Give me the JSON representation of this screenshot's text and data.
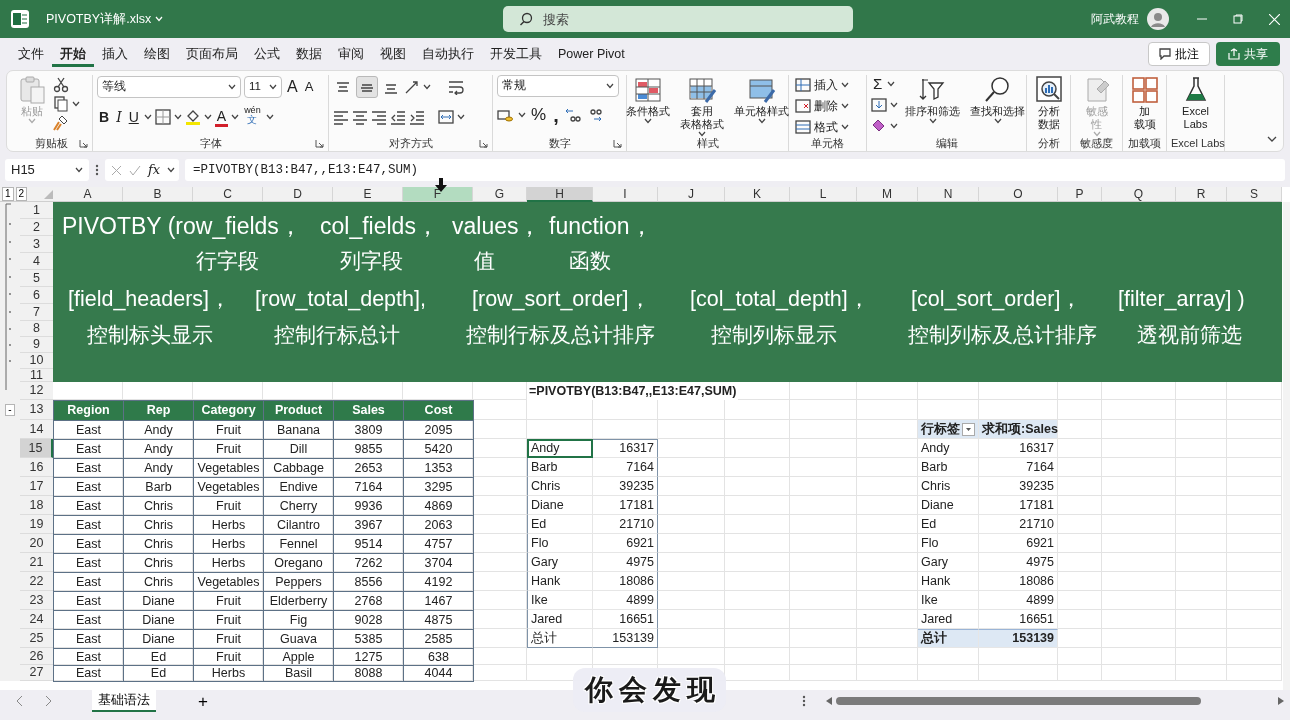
{
  "title_bar": {
    "file_name": "PIVOTBY详解.xlsx",
    "search_placeholder": "搜索",
    "user": "阿武教程"
  },
  "menu_tabs": [
    {
      "label": "文件",
      "selected": false
    },
    {
      "label": "开始",
      "selected": true
    },
    {
      "label": "插入",
      "selected": false
    },
    {
      "label": "绘图",
      "selected": false
    },
    {
      "label": "页面布局",
      "selected": false
    },
    {
      "label": "公式",
      "selected": false
    },
    {
      "label": "数据",
      "selected": false
    },
    {
      "label": "审阅",
      "selected": false
    },
    {
      "label": "视图",
      "selected": false
    },
    {
      "label": "自动执行",
      "selected": false
    },
    {
      "label": "开发工具",
      "selected": false
    },
    {
      "label": "Power Pivot",
      "selected": false
    }
  ],
  "menu_actions": [
    {
      "label": "批注",
      "kind": "comment"
    },
    {
      "label": "共享",
      "kind": "share"
    }
  ],
  "ribbon": [
    {
      "kind": "clipboard",
      "label": "剪贴板",
      "launcher": true,
      "paste": {
        "label": "粘贴",
        "disabled": true
      }
    },
    {
      "kind": "font",
      "label": "字体",
      "launcher": true,
      "font_name": "等线",
      "font_size": "11",
      "size_buttons": [
        "A",
        "A"
      ],
      "style_buttons": [
        "B",
        "I",
        "U"
      ],
      "font_color": "A",
      "phonetic": [
        "wén",
        "文"
      ]
    },
    {
      "kind": "alignment",
      "label": "对齐方式",
      "launcher": true,
      "vertical_align": [
        {
          "selected": false
        },
        {
          "selected": true
        },
        {
          "selected": false
        }
      ]
    },
    {
      "kind": "number",
      "label": "数字",
      "launcher": true,
      "number_format": "常规",
      "style_buttons": [
        "%",
        ","
      ]
    },
    {
      "kind": "large",
      "label": "样式",
      "launcher": false,
      "buttons": [
        {
          "lines": [
            "条件格式"
          ],
          "dropdown": true,
          "disabled": false
        },
        {
          "lines": [
            "套用",
            "表格格式"
          ],
          "dropdown": true,
          "disabled": false
        },
        {
          "lines": [
            "单元格样式"
          ],
          "dropdown": true,
          "disabled": false
        }
      ]
    },
    {
      "kind": "cells",
      "label": "单元格",
      "launcher": false,
      "buttons": [
        "插入",
        "删除",
        "格式"
      ]
    },
    {
      "kind": "editing",
      "label": "编辑",
      "launcher": false,
      "autosum": "Σ",
      "buttons": [
        {
          "lines": [
            "排序和筛选"
          ],
          "dropdown": true,
          "disabled": false
        },
        {
          "lines": [
            "查找和选择"
          ],
          "dropdown": true,
          "disabled": false
        }
      ]
    },
    {
      "kind": "large",
      "label": "分析",
      "launcher": false,
      "buttons": [
        {
          "lines": [
            "分析",
            "数据"
          ],
          "dropdown": false,
          "disabled": false
        }
      ]
    },
    {
      "kind": "large",
      "label": "敏感度",
      "launcher": false,
      "buttons": [
        {
          "lines": [
            "敏感",
            "性"
          ],
          "dropdown": true,
          "disabled": true
        }
      ]
    },
    {
      "kind": "large",
      "label": "加载项",
      "launcher": false,
      "buttons": [
        {
          "lines": [
            "加",
            "载项"
          ],
          "dropdown": false,
          "disabled": false
        }
      ]
    },
    {
      "kind": "large",
      "label": "Excel Labs",
      "launcher": false,
      "buttons": [
        {
          "lines": [
            "Excel",
            "Labs"
          ],
          "dropdown": false,
          "disabled": false
        }
      ]
    }
  ],
  "formula_bar": {
    "name_box": "H15",
    "fx": "fx",
    "formula": "=PIVOTBY(B13:B47,,E13:E47,SUM)"
  },
  "outline_levels": [
    "1",
    "2"
  ],
  "outline_collapse": "-",
  "columns": [
    {
      "label": "A",
      "selected": false,
      "drop_target": false
    },
    {
      "label": "B",
      "selected": false,
      "drop_target": false
    },
    {
      "label": "C",
      "selected": false,
      "drop_target": false
    },
    {
      "label": "D",
      "selected": false,
      "drop_target": false
    },
    {
      "label": "E",
      "selected": false,
      "drop_target": false
    },
    {
      "label": "F",
      "selected": false,
      "drop_target": true
    },
    {
      "label": "G",
      "selected": false,
      "drop_target": false
    },
    {
      "label": "H",
      "selected": true,
      "drop_target": false
    },
    {
      "label": "I",
      "selected": false,
      "drop_target": false
    },
    {
      "label": "J",
      "selected": false,
      "drop_target": false
    },
    {
      "label": "K",
      "selected": false,
      "drop_target": false
    },
    {
      "label": "L",
      "selected": false,
      "drop_target": false
    },
    {
      "label": "M",
      "selected": false,
      "drop_target": false
    },
    {
      "label": "N",
      "selected": false,
      "drop_target": false
    },
    {
      "label": "O",
      "selected": false,
      "drop_target": false
    },
    {
      "label": "P",
      "selected": false,
      "drop_target": false
    },
    {
      "label": "Q",
      "selected": false,
      "drop_target": false
    },
    {
      "label": "R",
      "selected": false,
      "drop_target": false
    },
    {
      "label": "S",
      "selected": false,
      "drop_target": false
    }
  ],
  "rows": [
    {
      "label": "1",
      "selected": false
    },
    {
      "label": "2",
      "selected": false
    },
    {
      "label": "3",
      "selected": false
    },
    {
      "label": "4",
      "selected": false
    },
    {
      "label": "5",
      "selected": false
    },
    {
      "label": "6",
      "selected": false
    },
    {
      "label": "7",
      "selected": false
    },
    {
      "label": "8",
      "selected": false
    },
    {
      "label": "9",
      "selected": false
    },
    {
      "label": "10",
      "selected": false
    },
    {
      "label": "11",
      "selected": false
    },
    {
      "label": "12",
      "selected": false
    },
    {
      "label": "13",
      "selected": false
    },
    {
      "label": "14",
      "selected": false
    },
    {
      "label": "15",
      "selected": true
    },
    {
      "label": "16",
      "selected": false
    },
    {
      "label": "17",
      "selected": false
    },
    {
      "label": "18",
      "selected": false
    },
    {
      "label": "19",
      "selected": false
    },
    {
      "label": "20",
      "selected": false
    },
    {
      "label": "21",
      "selected": false
    },
    {
      "label": "22",
      "selected": false
    },
    {
      "label": "23",
      "selected": false
    },
    {
      "label": "24",
      "selected": false
    },
    {
      "label": "25",
      "selected": false
    },
    {
      "label": "26",
      "selected": false
    },
    {
      "label": "27",
      "selected": false
    }
  ],
  "banner": {
    "syntax": [
      "PIVOTBY (row_fields，",
      "col_fields，",
      "values，",
      "function，"
    ],
    "syntax_meaning": [
      "行字段",
      "列字段",
      "值",
      "函数"
    ],
    "optional": [
      "[field_headers]，",
      "[row_total_depth],",
      "[row_sort_order]，",
      "[col_total_depth]，",
      "[col_sort_order]，",
      "[filter_array] )"
    ],
    "optional_meaning": [
      "控制标头显示",
      "控制行标总计",
      "控制行标及总计排序",
      "控制列标显示",
      "控制列标及总计排序",
      "透视前筛选"
    ]
  },
  "source_table": {
    "columns": [
      "Region",
      "Rep",
      "Category",
      "Product",
      "Sales",
      "Cost"
    ],
    "rows": [
      [
        "East",
        "Andy",
        "Fruit",
        "Banana",
        "3809",
        "2095"
      ],
      [
        "East",
        "Andy",
        "Fruit",
        "Dill",
        "9855",
        "5420"
      ],
      [
        "East",
        "Andy",
        "Vegetables",
        "Cabbage",
        "2653",
        "1353"
      ],
      [
        "East",
        "Barb",
        "Vegetables",
        "Endive",
        "7164",
        "3295"
      ],
      [
        "East",
        "Chris",
        "Fruit",
        "Cherry",
        "9936",
        "4869"
      ],
      [
        "East",
        "Chris",
        "Herbs",
        "Cilantro",
        "3967",
        "2063"
      ],
      [
        "East",
        "Chris",
        "Herbs",
        "Fennel",
        "9514",
        "4757"
      ],
      [
        "East",
        "Chris",
        "Herbs",
        "Oregano",
        "7262",
        "3704"
      ],
      [
        "East",
        "Chris",
        "Vegetables",
        "Peppers",
        "8556",
        "4192"
      ],
      [
        "East",
        "Diane",
        "Fruit",
        "Elderberry",
        "2768",
        "1467"
      ],
      [
        "East",
        "Diane",
        "Fruit",
        "Fig",
        "9028",
        "4875"
      ],
      [
        "East",
        "Diane",
        "Fruit",
        "Guava",
        "5385",
        "2585"
      ],
      [
        "East",
        "Ed",
        "Fruit",
        "Apple",
        "1275",
        "638"
      ],
      [
        "East",
        "Ed",
        "Herbs",
        "Basil",
        "8088",
        "4044"
      ]
    ]
  },
  "pivotby_result": {
    "formula": "=PIVOTBY(B13:B47,,E13:E47,SUM)",
    "rows": [
      {
        "label": "Andy",
        "value": "16317",
        "selected": true
      },
      {
        "label": "Barb",
        "value": "7164",
        "selected": false
      },
      {
        "label": "Chris",
        "value": "39235",
        "selected": false
      },
      {
        "label": "Diane",
        "value": "17181",
        "selected": false
      },
      {
        "label": "Ed",
        "value": "21710",
        "selected": false
      },
      {
        "label": "Flo",
        "value": "6921",
        "selected": false
      },
      {
        "label": "Gary",
        "value": "4975",
        "selected": false
      },
      {
        "label": "Hank",
        "value": "18086",
        "selected": false
      },
      {
        "label": "Ike",
        "value": "4899",
        "selected": false
      },
      {
        "label": "Jared",
        "value": "16651",
        "selected": false
      },
      {
        "label": "总计",
        "value": "153139",
        "selected": false
      }
    ]
  },
  "pivot_table": {
    "header": [
      "行标签",
      "求和项:Sales"
    ],
    "rows": [
      [
        "Andy",
        "16317"
      ],
      [
        "Barb",
        "7164"
      ],
      [
        "Chris",
        "39235"
      ],
      [
        "Diane",
        "17181"
      ],
      [
        "Ed",
        "21710"
      ],
      [
        "Flo",
        "6921"
      ],
      [
        "Gary",
        "4975"
      ],
      [
        "Hank",
        "18086"
      ],
      [
        "Ike",
        "4899"
      ],
      [
        "Jared",
        "16651"
      ]
    ],
    "total": [
      "总计",
      "153139"
    ]
  },
  "sheet_tabs": [
    {
      "label": "基础语法",
      "selected": true
    }
  ],
  "new_sheet": "+",
  "subtitle": "你会发现"
}
